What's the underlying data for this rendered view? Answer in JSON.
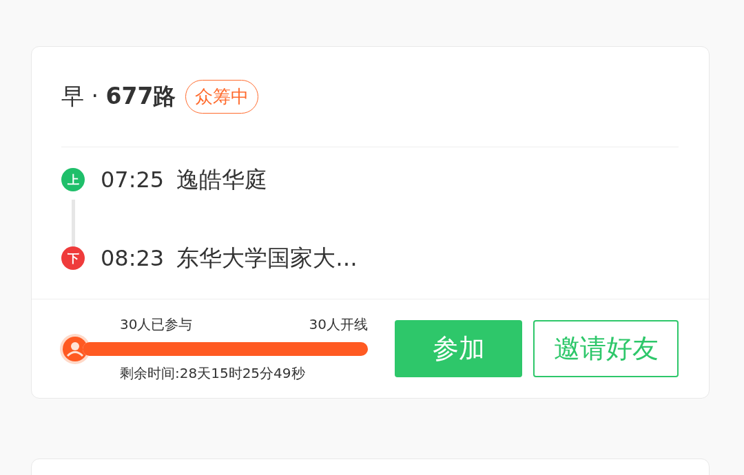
{
  "route": {
    "title": "早 · **677路**",
    "tag": "众筹中"
  },
  "stops": [
    {
      "badge": "上",
      "color": "#1fbf6a",
      "time": "07:25",
      "name": "逸皓华庭"
    },
    {
      "badge": "下",
      "color": "#ef3b3b",
      "time": "08:23",
      "name": "东华大学国家大..."
    }
  ],
  "progress": {
    "joined": "30人已参与",
    "target": "30人开线",
    "level": 1,
    "remaining": "剩余时间:28天15时25分49秒"
  },
  "buttons": [
    {
      "kind": "primary",
      "label": "参加"
    },
    {
      "kind": "outline",
      "label": "邀请好友"
    }
  ]
}
